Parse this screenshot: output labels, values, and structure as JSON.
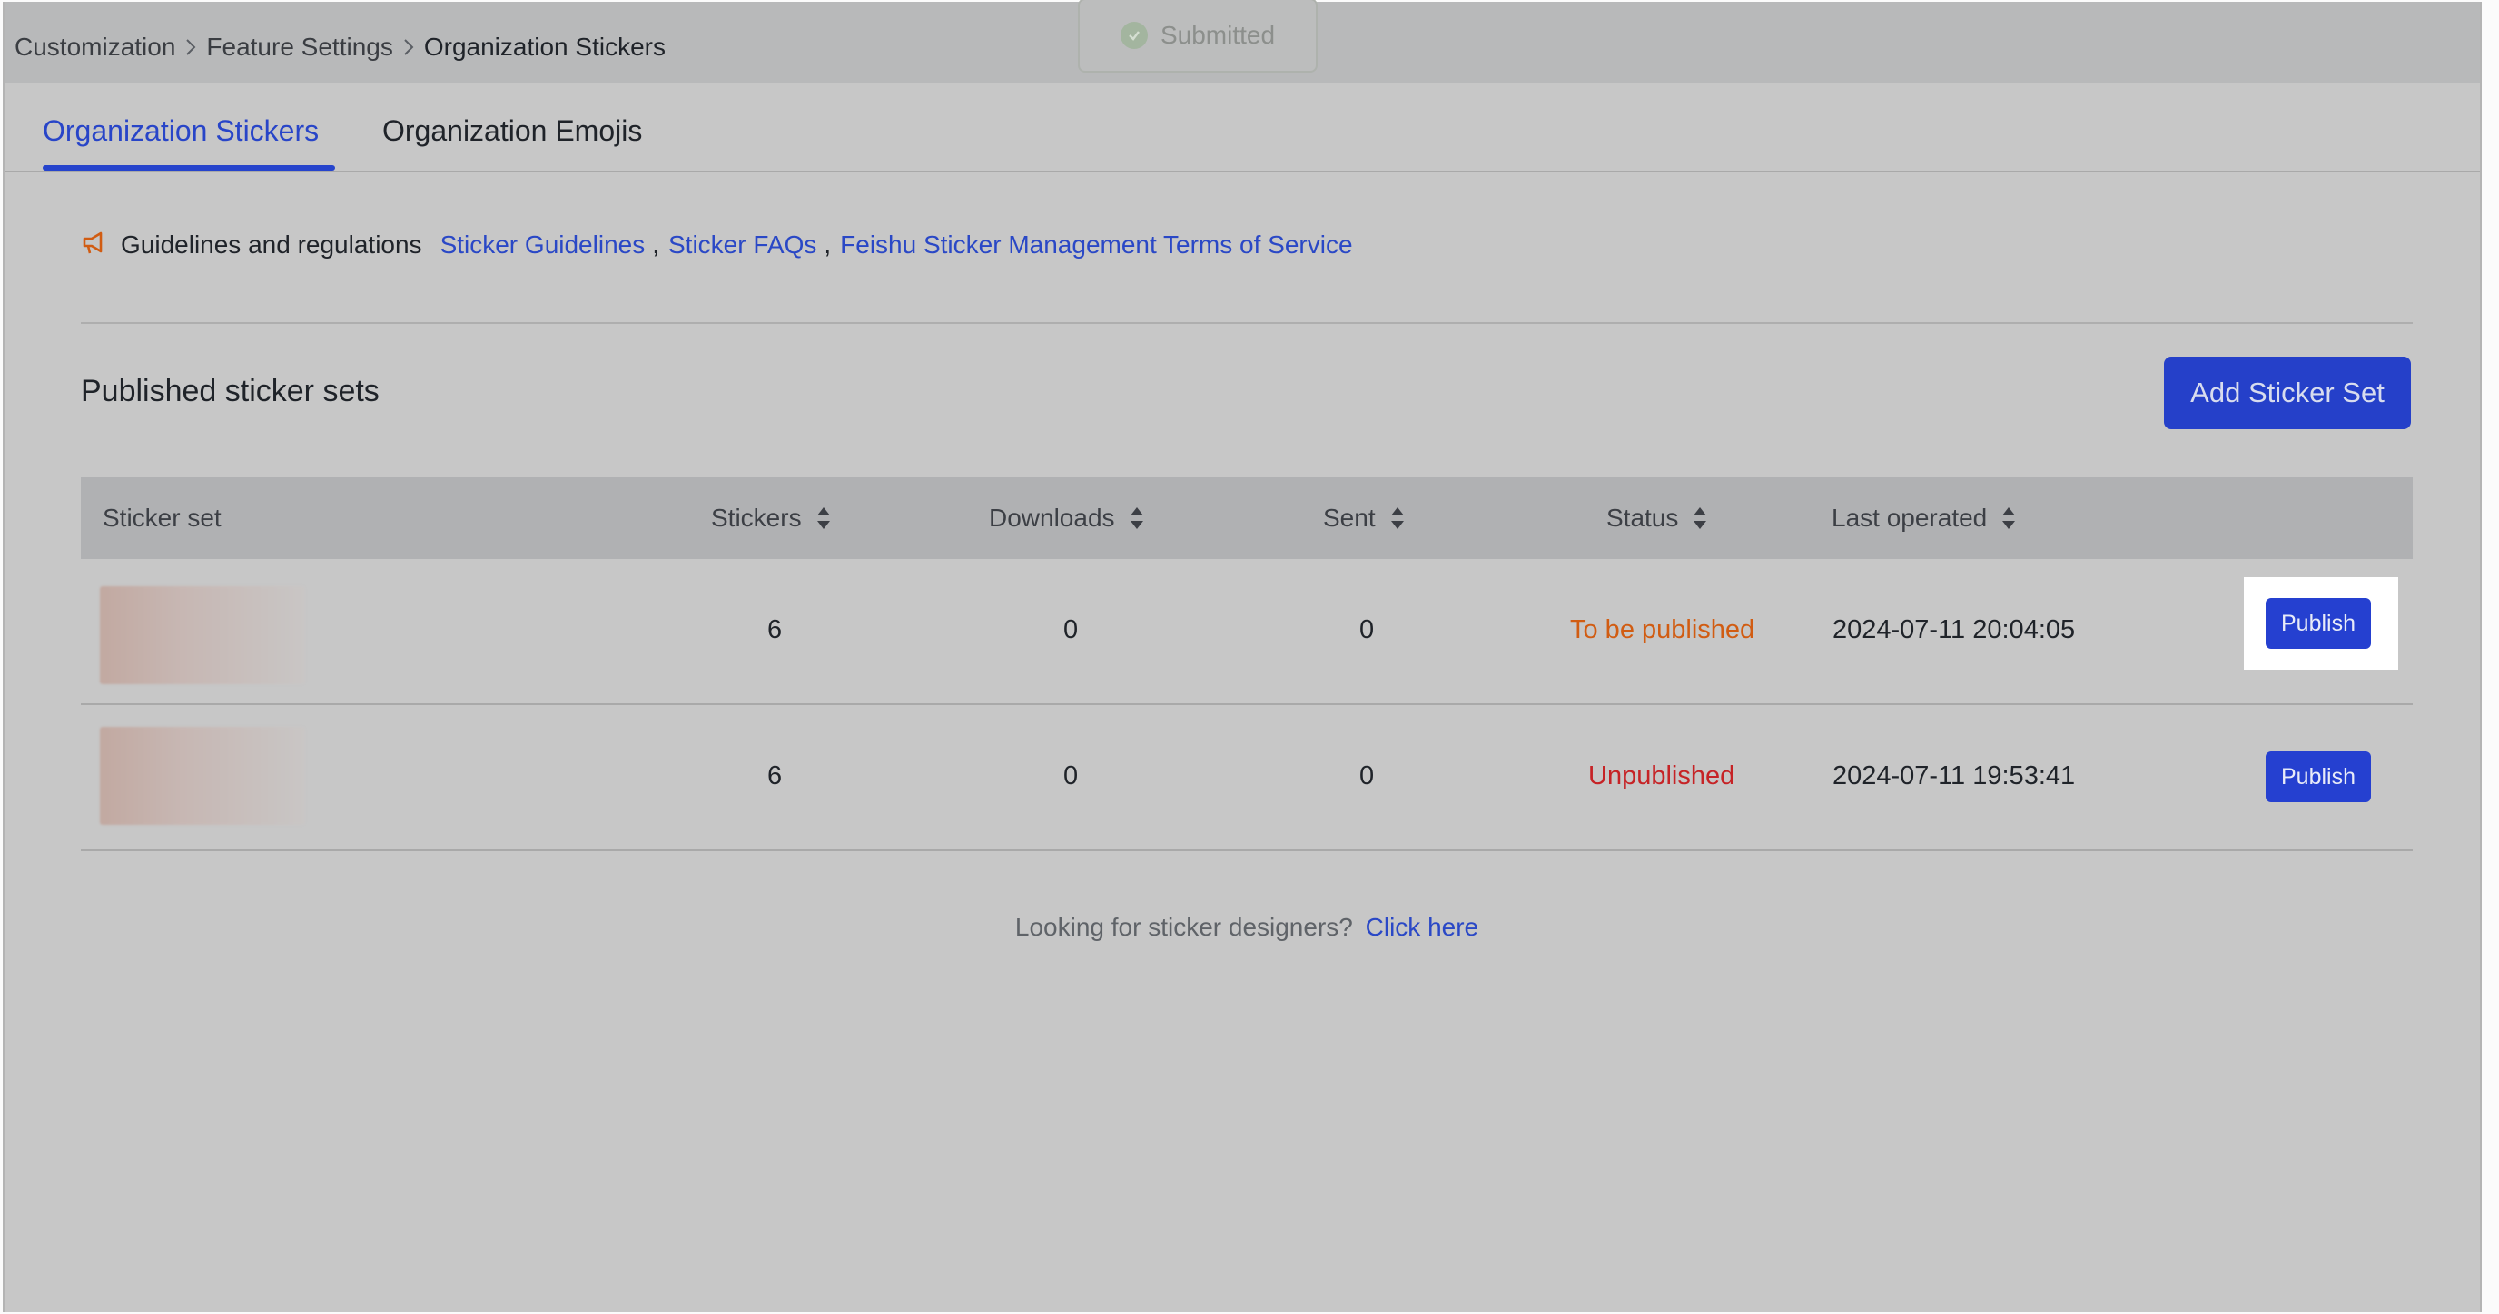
{
  "breadcrumb": {
    "items": [
      "Customization",
      "Feature Settings",
      "Organization Stickers"
    ]
  },
  "toast": {
    "text": "Submitted",
    "icon": "check-circle-icon"
  },
  "tabs": [
    {
      "label": "Organization Stickers",
      "active": true
    },
    {
      "label": "Organization Emojis",
      "active": false
    }
  ],
  "guidelines": {
    "icon": "megaphone-icon",
    "label": "Guidelines and regulations",
    "links": [
      "Sticker Guidelines",
      "Sticker FAQs",
      "Feishu Sticker Management Terms of Service"
    ],
    "separator": ","
  },
  "section": {
    "title": "Published sticker sets",
    "add_button": "Add Sticker Set"
  },
  "table": {
    "columns": [
      "Sticker set",
      "Stickers",
      "Downloads",
      "Sent",
      "Status",
      "Last operated"
    ],
    "rows": [
      {
        "stickers": "6",
        "downloads": "0",
        "sent": "0",
        "status": "To be published",
        "last_operated": "2024-07-11 20:04:05",
        "action": "Publish"
      },
      {
        "stickers": "6",
        "downloads": "0",
        "sent": "0",
        "status": "Unpublished",
        "last_operated": "2024-07-11 19:53:41",
        "action": "Publish"
      }
    ]
  },
  "footer": {
    "question": "Looking for sticker designers?",
    "link": "Click here"
  },
  "colors": {
    "accent": "#2540c9",
    "status_to_be_published": "#d15c12",
    "status_unpublished": "#c62326"
  }
}
